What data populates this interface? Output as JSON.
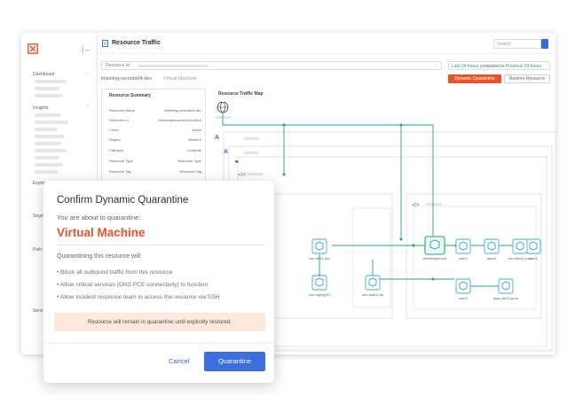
{
  "app": {
    "title": "Resource Traffic",
    "search_placeholder": "Search",
    "resource_id_label": "Resource Id",
    "time_current": "Last 24 hours",
    "time_compared": "compared to",
    "time_previous": "Previous 24 hours",
    "resource_name": "ticketing-records04-dev",
    "resource_type": "Virtual Machine",
    "btn_dynamic_quarantine": "Dynamic Quarantine",
    "btn_restore_resource": "Restore Resource",
    "colors": {
      "accent": "#e8542a",
      "primary": "#3b6fe0",
      "success": "#23a86b"
    }
  },
  "sidebar": {
    "sections": [
      "Dashboard",
      "Insights",
      "Explore",
      "Segm",
      "Polic",
      "Servi"
    ]
  },
  "summary": {
    "title": "Resource Summary",
    "rows": [
      {
        "k": "Resource Name",
        "v": "ticketing-records04-dev"
      },
      {
        "k": "Resource Id",
        "v": "/subscriptions/ba1b44-6bcb"
      },
      {
        "k": "Cloud",
        "v": "Azure"
      },
      {
        "k": "Region",
        "v": "WestUS"
      },
      {
        "k": "Category",
        "v": "Compute"
      },
      {
        "k": "Resource Type",
        "v": "Resource Type"
      },
      {
        "k": "Resource Tag",
        "v": "Resource Tag"
      }
    ]
  },
  "map": {
    "title": "Resource Traffic Map",
    "nodes": [
      {
        "label": "crm-db01-dev"
      },
      {
        "label": "ticketingrecord"
      },
      {
        "label": "user1"
      },
      {
        "label": "asyn4"
      },
      {
        "label": "hrm-db01-prod"
      },
      {
        "label": "crm-cfgmgr01"
      },
      {
        "label": "crm-asa01-ds"
      },
      {
        "label": "user3"
      },
      {
        "label": "asso-db03-prod"
      }
    ]
  },
  "modal": {
    "title": "Confirm Dynamic Quarantine",
    "subtitle": "You are about to quarantine:",
    "target": "Virtual Machine",
    "will_heading": "Quarantining this resource will:",
    "bullets": [
      "• Block all outbound traffic from this resource",
      "• Allow critical services (DNS PCE connectivity) to function",
      "• Allow incident response team to access the resource via SSH"
    ],
    "note": "Resource will remain in quarantine until explicitly restored.",
    "cancel": "Cancel",
    "confirm": "Quarantine"
  }
}
